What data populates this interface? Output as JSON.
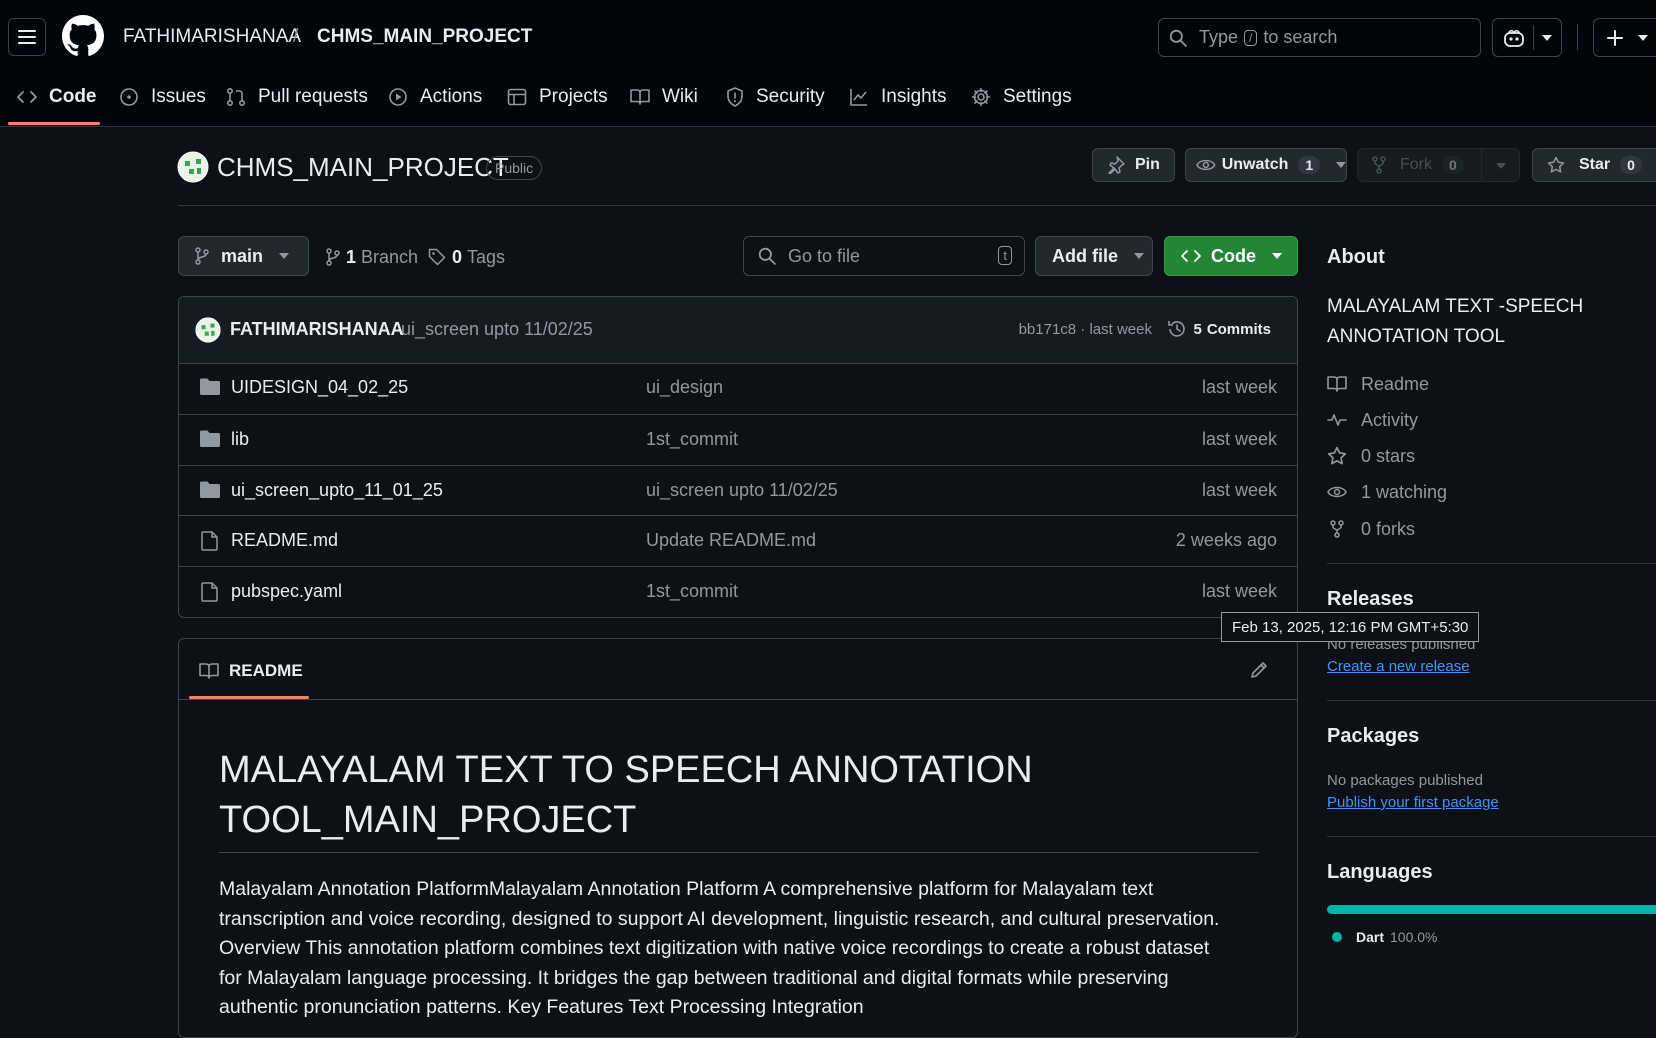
{
  "header": {
    "owner": "FATHIMARISHANAA",
    "separator": "/",
    "repo": "CHMS_MAIN_PROJECT",
    "search": {
      "prefix": "Type",
      "key": "/",
      "suffix": "to search"
    }
  },
  "nav": {
    "tabs": [
      {
        "label": "Code",
        "icon": "code-icon"
      },
      {
        "label": "Issues",
        "icon": "issue-icon"
      },
      {
        "label": "Pull requests",
        "icon": "pull-request-icon"
      },
      {
        "label": "Actions",
        "icon": "play-icon"
      },
      {
        "label": "Projects",
        "icon": "table-icon"
      },
      {
        "label": "Wiki",
        "icon": "book-icon"
      },
      {
        "label": "Security",
        "icon": "shield-icon"
      },
      {
        "label": "Insights",
        "icon": "graph-icon"
      },
      {
        "label": "Settings",
        "icon": "gear-icon"
      }
    ]
  },
  "repo": {
    "name": "CHMS_MAIN_PROJECT",
    "visibility": "Public",
    "pin_label": "Pin",
    "watch_label": "Unwatch",
    "watch_count": "1",
    "fork_label": "Fork",
    "fork_count": "0",
    "star_label": "Star",
    "star_count": "0"
  },
  "toolbar": {
    "branch": "main",
    "branches_count": "1",
    "branches_label": "Branch",
    "tags_count": "0",
    "tags_label": "Tags",
    "go_to_file": "Go to file",
    "go_to_file_key": "t",
    "add_file": "Add file",
    "code": "Code"
  },
  "commit": {
    "author": "FATHIMARISHANAA",
    "message": "ui_screen upto 11/02/25",
    "sha_time": "bb171c8 · last week",
    "commits_count": "5",
    "commits_label": "Commits"
  },
  "files": [
    {
      "type": "folder",
      "name": "UIDESIGN_04_02_25",
      "message": "ui_design",
      "time": "last week"
    },
    {
      "type": "folder",
      "name": "lib",
      "message": "1st_commit",
      "time": "last week"
    },
    {
      "type": "folder",
      "name": "ui_screen_upto_11_01_25",
      "message": "ui_screen upto 11/02/25",
      "time": "last week"
    },
    {
      "type": "file",
      "name": "README.md",
      "message": "Update README.md",
      "time": "2 weeks ago"
    },
    {
      "type": "file",
      "name": "pubspec.yaml",
      "message": "1st_commit",
      "time": "last week"
    }
  ],
  "readme": {
    "tab_label": "README",
    "heading_line1": "MALAYALAM TEXT TO SPEECH ANNOTATION",
    "heading_line2": "TOOL_MAIN_PROJECT",
    "body_lines": [
      "Malayalam Annotation PlatformMalayalam Annotation Platform A comprehensive platform for Malayalam text",
      "transcription and voice recording, designed to support AI development, linguistic research, and cultural preservation.",
      "Overview This annotation platform combines text digitization with native voice recordings to create a robust dataset",
      "for Malayalam language processing. It bridges the gap between traditional and digital formats while preserving",
      "authentic pronunciation patterns. Key Features Text Processing Integration"
    ]
  },
  "about": {
    "heading": "About",
    "description_line1": "MALAYALAM TEXT -SPEECH",
    "description_line2": "ANNOTATION TOOL",
    "items": [
      {
        "icon": "book-icon",
        "label": "Readme"
      },
      {
        "icon": "pulse-icon",
        "label": "Activity"
      },
      {
        "icon": "star-icon",
        "label": "0 stars"
      },
      {
        "icon": "eye-icon",
        "label": "1 watching"
      },
      {
        "icon": "fork-icon",
        "label": "0 forks"
      }
    ]
  },
  "releases": {
    "heading": "Releases",
    "empty": "No releases published",
    "create_link": "Create a new release"
  },
  "packages": {
    "heading": "Packages",
    "empty": "No packages published",
    "publish_link": "Publish your first package"
  },
  "languages": {
    "heading": "Languages",
    "items": [
      {
        "name": "Dart",
        "percent": "100.0%",
        "fraction": 1.0,
        "color": "#00b4ab"
      }
    ]
  },
  "tooltip": {
    "text": "Feb 13, 2025, 12:16 PM GMT+5:30"
  },
  "colors": {
    "accent_underline": "#f78166",
    "code_button": "#238636",
    "link": "#4493f8",
    "dart": "#00b4ab"
  }
}
